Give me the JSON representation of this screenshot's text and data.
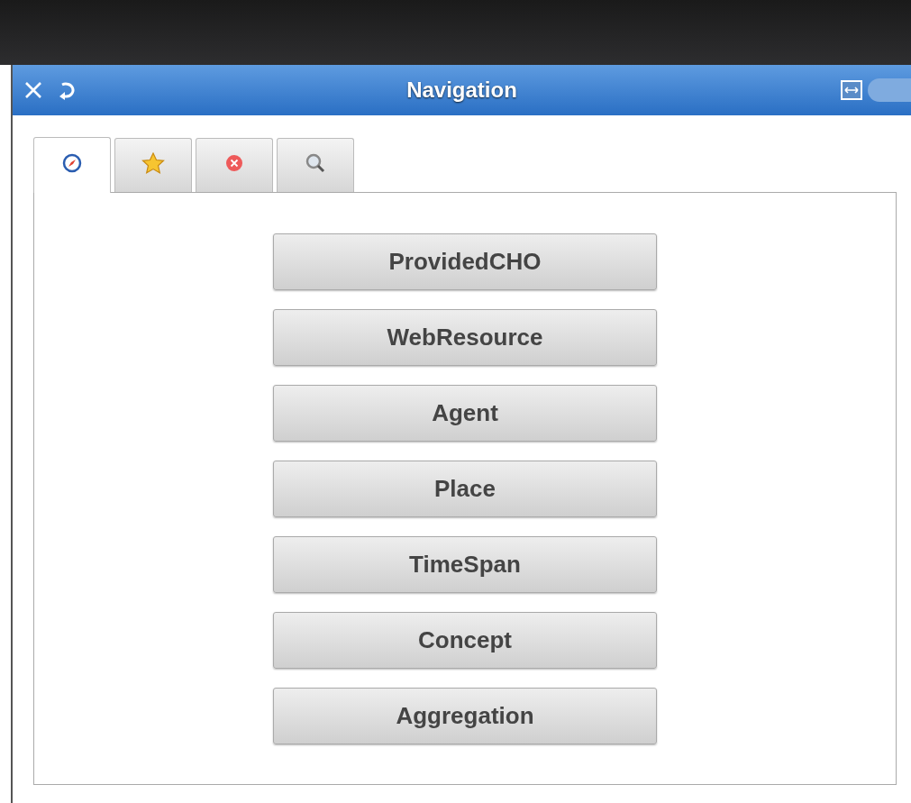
{
  "window": {
    "title": "Navigation"
  },
  "tabs": [
    {
      "kind": "compass",
      "selected": true
    },
    {
      "kind": "star",
      "selected": false
    },
    {
      "kind": "error",
      "selected": false
    },
    {
      "kind": "search",
      "selected": false
    }
  ],
  "buttons": [
    "ProvidedCHO",
    "WebResource",
    "Agent",
    "Place",
    "TimeSpan",
    "Concept",
    "Aggregation"
  ]
}
